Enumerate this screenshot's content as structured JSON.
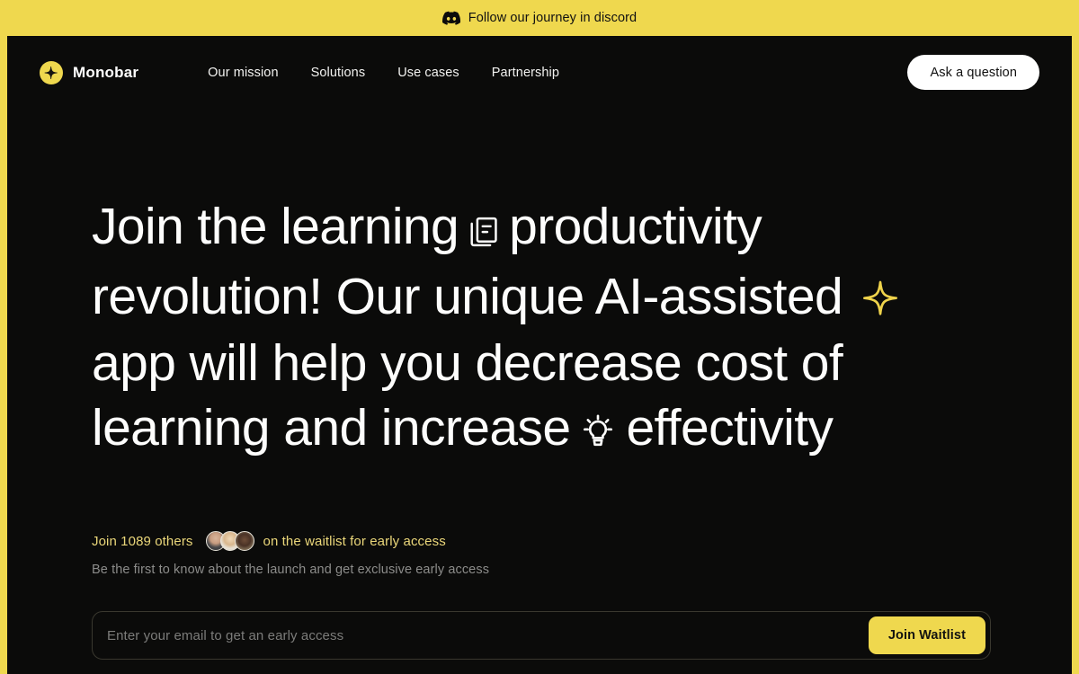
{
  "announcement": {
    "icon": "discord-icon",
    "text": "Follow our journey in discord"
  },
  "navbar": {
    "brand": {
      "logo_icon": "sparkle-logo-icon",
      "name": "Monobar"
    },
    "links": [
      {
        "label": "Our mission"
      },
      {
        "label": "Solutions"
      },
      {
        "label": "Use cases"
      },
      {
        "label": "Partnership"
      }
    ],
    "cta_label": "Ask a question"
  },
  "hero": {
    "headline": {
      "part1": "Join the learning",
      "icon1": "documents-icon",
      "part2": "productivity revolution! Our unique AI-assisted",
      "icon2": "sparkle-icon",
      "part3": "app will help you decrease cost of learning and increase",
      "icon3": "lightbulb-icon",
      "part4": "effectivity"
    },
    "social_proof": {
      "prefix": "Join 1089 others",
      "count": "1089",
      "suffix": "on the waitlist for early access",
      "avatars": [
        {
          "name": "avatar-1"
        },
        {
          "name": "avatar-2"
        },
        {
          "name": "avatar-3"
        }
      ]
    },
    "sub_note": "Be the first to know about the launch and get exclusive early access",
    "form": {
      "email_placeholder": "Enter your email to get an early access",
      "email_value": "",
      "submit_label": "Join Waitlist"
    }
  },
  "colors": {
    "brand_yellow": "#EFD84E",
    "panel_dark": "#0B0B0A",
    "text_white": "#FDFDFC",
    "text_muted": "#8C8C8A",
    "accent_text": "#EBD77A"
  }
}
